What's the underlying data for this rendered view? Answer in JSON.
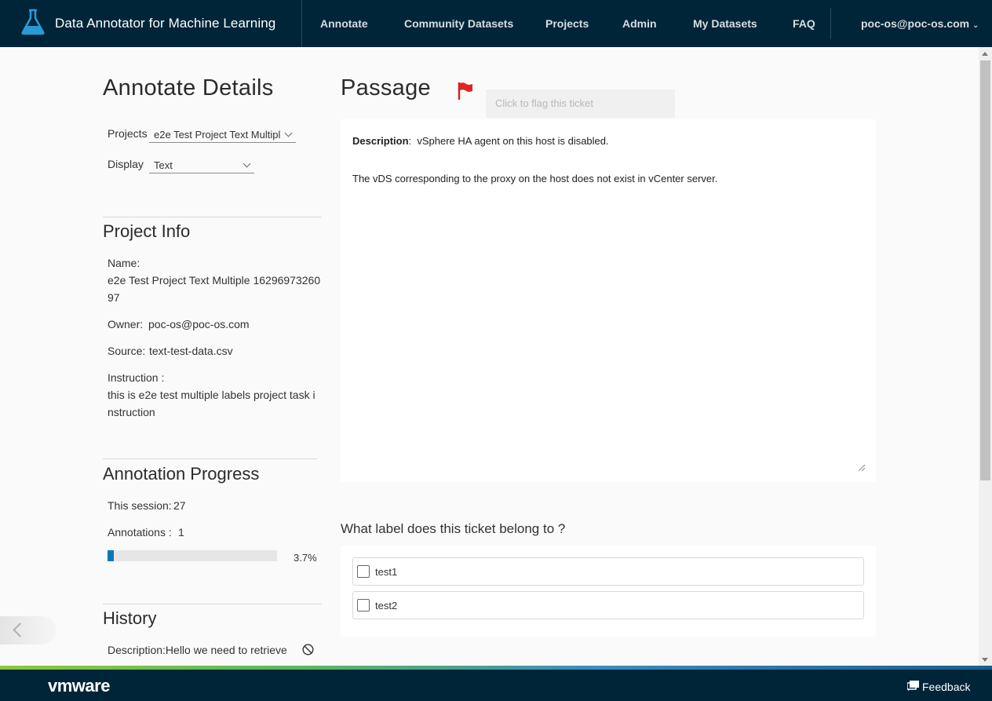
{
  "header": {
    "app_title": "Data Annotator for Machine Learning",
    "logo_icon": "flask-icon",
    "nav": [
      "Annotate",
      "Community Datasets",
      "Projects",
      "Admin",
      "My Datasets",
      "FAQ"
    ],
    "user": "poc-os@poc-os.com"
  },
  "details": {
    "title": "Annotate Details",
    "projects_label": "Projects",
    "projects_value": "e2e Test Project Text Multiple 1629697326097",
    "display_label": "Display",
    "display_value": "Text"
  },
  "project_info": {
    "title": "Project Info",
    "name_label": "Name:",
    "name_line1": "e2e Test Project Text Multiple 16296973260",
    "name_line2": "97",
    "owner_label": "Owner:",
    "owner_value": "poc-os@poc-os.com",
    "source_label": "Source:",
    "source_value": "text-test-data.csv",
    "instruction_label": "Instruction :",
    "instruction_line1": "this is e2e test multiple labels project task i",
    "instruction_line2": "nstruction"
  },
  "progress": {
    "title": "Annotation Progress",
    "session_label": "This session:",
    "session_value": "27",
    "annotations_label": "Annotations :",
    "annotations_value": "1",
    "percent": 3.7,
    "percent_label": "3.7%"
  },
  "history": {
    "title": "History",
    "item": "Description:Hello we need to retrieve",
    "item_icon": "block-icon"
  },
  "passage": {
    "title": "Passage",
    "flag_icon": "flag-icon",
    "flag_tip": "Click to flag this ticket",
    "desc_label": "Description",
    "desc_text": "vSphere HA agent on this host is disabled.",
    "body": "The vDS corresponding to the proxy on the host does not exist in vCenter server."
  },
  "question": {
    "text": "What label does this ticket belong to ?",
    "options": [
      "test1",
      "test2"
    ]
  },
  "footer": {
    "brand": "vmware",
    "feedback": "Feedback",
    "feedback_icon": "feedback-icon"
  },
  "colors": {
    "header_bg": "#002538",
    "accent": "#0079b8",
    "flag": "#e02424"
  }
}
